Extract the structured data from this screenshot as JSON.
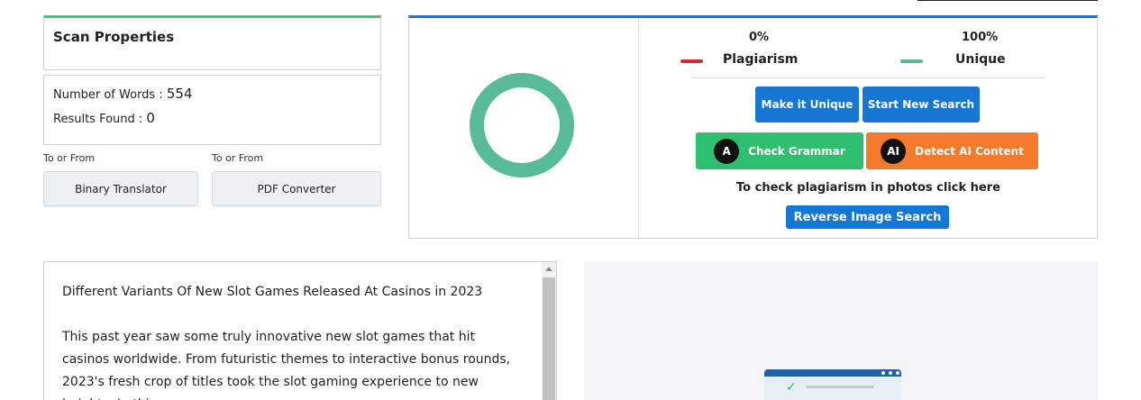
{
  "scan": {
    "title": "Scan Properties",
    "words_label": "Number of Words : ",
    "words_value": "554",
    "results_label": "Results Found : ",
    "results_value": "0"
  },
  "tools": [
    {
      "label": "To or From",
      "button": "Binary Translator"
    },
    {
      "label": "To or From",
      "button": "PDF Converter"
    }
  ],
  "result": {
    "plagiarism_pct": "0%",
    "unique_pct": "100%",
    "plagiarism_label": "Plagiarism",
    "unique_label": "Unique",
    "plagiarism_fraction": 0,
    "unique_fraction": 1,
    "colors": {
      "plagiarism": "#d9282f",
      "unique": "#58bb98"
    },
    "buttons": {
      "make_unique": "Make it Unique",
      "start_new": "Start New Search",
      "check_grammar": "Check Grammar",
      "detect_ai": "Detect AI Content",
      "grammar_icon": "A",
      "ai_icon": "AI"
    },
    "photo_text": "To check plagiarism in photos click here",
    "reverse_image": "Reverse Image Search"
  },
  "document": {
    "title": "Different Variants Of New Slot Games Released At Casinos in 2023",
    "body": "This past year saw some truly innovative new slot games that hit casinos worldwide. From futuristic themes to interactive bonus rounds, 2023's fresh crop of titles took the slot gaming experience to new heights. In this"
  }
}
